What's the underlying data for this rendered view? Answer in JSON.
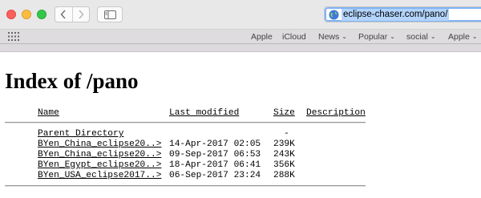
{
  "browser": {
    "url": "eclipse-chaser.com/pano/",
    "favorites": [
      {
        "label": "Apple",
        "dropdown": false
      },
      {
        "label": "iCloud",
        "dropdown": false
      },
      {
        "label": "News",
        "dropdown": true
      },
      {
        "label": "Popular",
        "dropdown": true
      },
      {
        "label": "social",
        "dropdown": true
      },
      {
        "label": "Apple",
        "dropdown": true
      }
    ]
  },
  "page": {
    "title": "Index of /pano",
    "columns": {
      "name": "Name",
      "modified": "Last modified",
      "size": "Size",
      "description": "Description"
    },
    "rows": [
      {
        "name": "Parent Directory",
        "modified": "",
        "size": "-"
      },
      {
        "name": "BYen_China_eclipse20..>",
        "modified": "14-Apr-2017 02:05",
        "size": "239K"
      },
      {
        "name": "BYen_China_eclipse20..>",
        "modified": "09-Sep-2017 06:53",
        "size": "243K"
      },
      {
        "name": "BYen_Egypt_eclipse20..>",
        "modified": "18-Apr-2017 06:41",
        "size": "356K"
      },
      {
        "name": "BYen_USA_eclipse2017..>",
        "modified": "06-Sep-2017 23:24",
        "size": "288K"
      }
    ]
  }
}
